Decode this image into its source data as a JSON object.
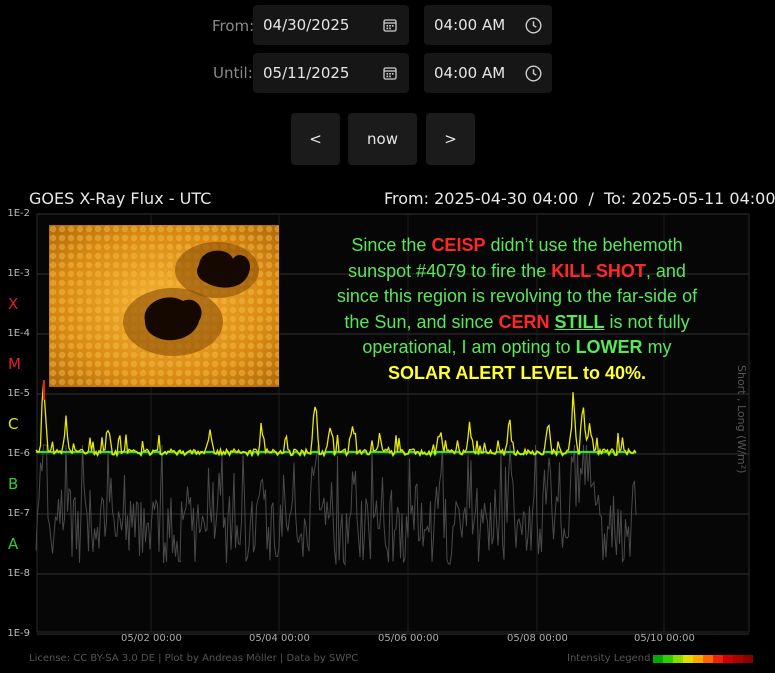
{
  "controls": {
    "from_label": "From:",
    "from_date": "04/30/2025",
    "from_time": "04:00 AM",
    "until_label": "Until:",
    "until_date": "05/11/2025",
    "until_time": "04:00 AM",
    "prev_label": "<",
    "now_label": "now",
    "next_label": ">"
  },
  "chart": {
    "title": "GOES X-Ray Flux - UTC",
    "range": "From: 2025-04-30 04:00  /  To: 2025-05-11 04:00",
    "y_ticks": [
      "1E-2",
      "1E-3",
      "1E-4",
      "1E-5",
      "1E-6",
      "1E-7",
      "1E-8",
      "1E-9"
    ],
    "classes": [
      {
        "label": "X",
        "color": "#e02020"
      },
      {
        "label": "M",
        "color": "#e02020"
      },
      {
        "label": "C",
        "color": "#e6e600"
      },
      {
        "label": "B",
        "color": "#33cc33"
      },
      {
        "label": "A",
        "color": "#33cc33"
      }
    ],
    "x_ticks": [
      "05/02 00:00",
      "05/04 00:00",
      "05/06 00:00",
      "05/08 00:00",
      "05/10 00:00"
    ],
    "right_axis": "Short , Long (W/m²)",
    "license": "License: CC BY-SA 3.0 DE | Plot by Andreas Möller | Data by SWPC",
    "legend_label": "Intensity Legend",
    "legend_colors": [
      "#00aa00",
      "#33cc00",
      "#88dd00",
      "#dddd00",
      "#ffaa00",
      "#ff6600",
      "#ee2200",
      "#cc0000",
      "#aa0000",
      "#880000"
    ]
  },
  "overlay": {
    "t1": "Since the ",
    "t2": "CEISP",
    "t3": " didn’t use the behemoth",
    "t4": "sunspot #4079 to fire the ",
    "t5": "KILL SHOT",
    "t6": ", and",
    "t7": "since this region is revolving to the far-side of",
    "t8": "the Sun, and since ",
    "t9": "CERN",
    "t10": " ",
    "t11": "STILL",
    "t12": " is not fully",
    "t13": "operational, I am opting to ",
    "t14": "LOWER",
    "t15": " my",
    "t16": "SOLAR ALERT LEVEL to 40%."
  }
}
